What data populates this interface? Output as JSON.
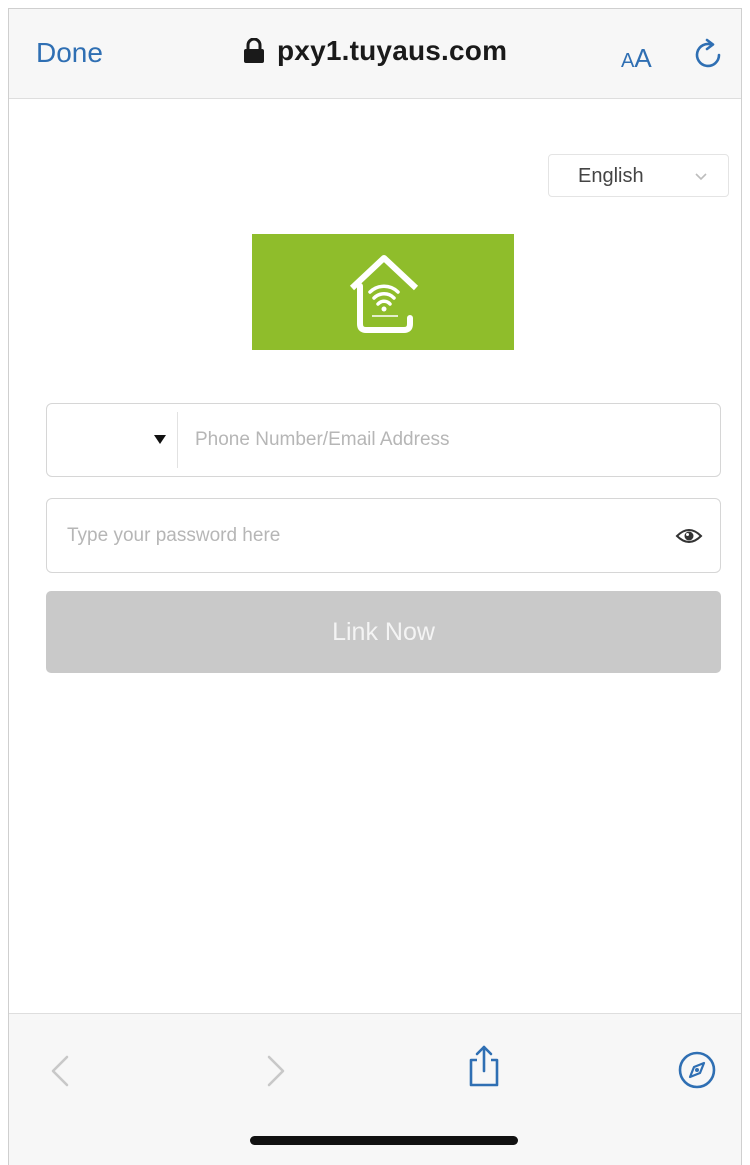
{
  "browser": {
    "done_label": "Done",
    "url": "pxy1.tuyaus.com",
    "text_size_small": "A",
    "text_size_large": "A",
    "accent_color": "#2f6fb3"
  },
  "language": {
    "selected": "English"
  },
  "logo": {
    "icon": "wifi-home-icon",
    "background_color": "#8fbd2b"
  },
  "form": {
    "phone_placeholder": "Phone Number/Email Address",
    "password_placeholder": "Type your password here",
    "submit_label": "Link Now",
    "submit_color": "#c9c9c9"
  },
  "toolbar": {
    "icons": [
      "back-icon",
      "forward-icon",
      "share-icon",
      "compass-icon"
    ]
  }
}
